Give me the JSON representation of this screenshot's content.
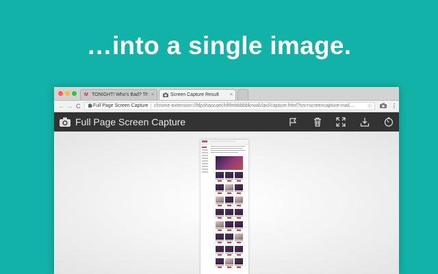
{
  "headline": "…into a single image.",
  "browser": {
    "tabs": [
      {
        "favicon": "gmail-icon",
        "title": "TONIGHT! Who's Bad? The Ul",
        "close": "×"
      },
      {
        "favicon": "camera-icon",
        "title": "Screen Capture Result",
        "close": "×"
      }
    ],
    "nav": {
      "back": "←",
      "forward": "→",
      "reload": "C"
    },
    "omnibox": {
      "extension_name": "Full Page Screen Capture",
      "url": "chrome-extension://fdpohaocaechififmbbbbbknoalclacl/capture.html?src=screencapture-mail..."
    },
    "menu_glyph": "⋮"
  },
  "app": {
    "title": "Full Page Screen Capture",
    "icons": [
      "camera-icon",
      "flag-icon",
      "trash-icon",
      "expand-icon",
      "download-icon",
      "timer-icon"
    ]
  }
}
